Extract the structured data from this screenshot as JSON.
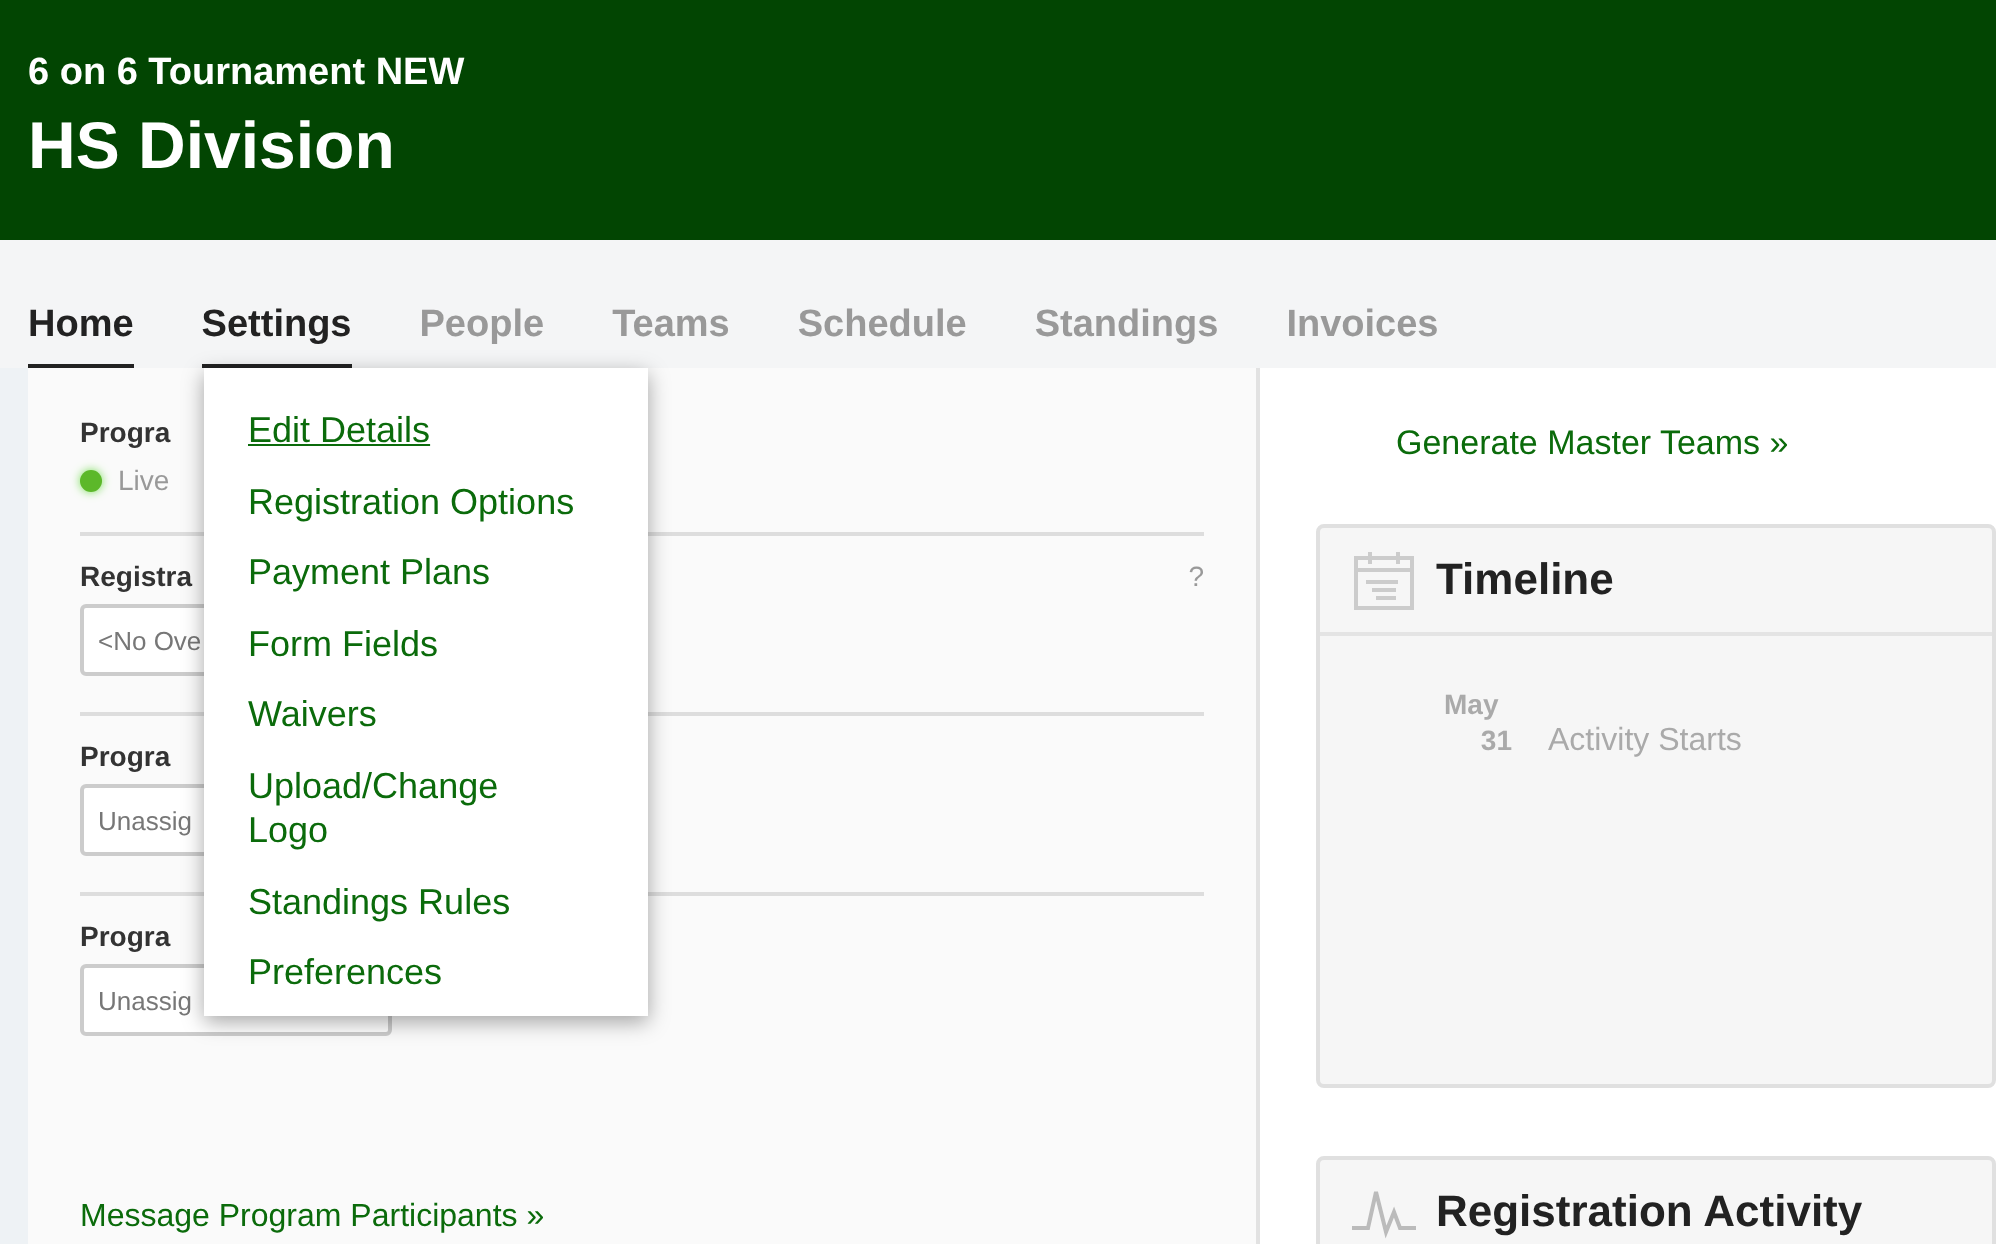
{
  "header": {
    "subtitle": "6 on 6 Tournament NEW",
    "title": "HS Division"
  },
  "tabs": [
    {
      "label": "Home",
      "active": true
    },
    {
      "label": "Settings",
      "active": true
    },
    {
      "label": "People",
      "active": false
    },
    {
      "label": "Teams",
      "active": false
    },
    {
      "label": "Schedule",
      "active": false
    },
    {
      "label": "Standings",
      "active": false
    },
    {
      "label": "Invoices",
      "active": false
    }
  ],
  "settings_menu": [
    {
      "label": "Edit Details",
      "highlighted": true
    },
    {
      "label": "Registration Options",
      "highlighted": false
    },
    {
      "label": "Payment Plans",
      "highlighted": false
    },
    {
      "label": "Form Fields",
      "highlighted": false
    },
    {
      "label": "Waivers",
      "highlighted": false
    },
    {
      "label": "Upload/Change\nLogo",
      "highlighted": false
    },
    {
      "label": "Standings Rules",
      "highlighted": false
    },
    {
      "label": "Preferences",
      "highlighted": false
    }
  ],
  "left_panel": {
    "status": {
      "label": "Progra",
      "value": "Live",
      "on": true
    },
    "fields": [
      {
        "label": "Registra",
        "value": "<No Ove",
        "help": "?"
      },
      {
        "label": "Progra",
        "value": "Unassig"
      },
      {
        "label": "Progra",
        "value": "Unassig"
      }
    ],
    "link": "Message Program Participants »"
  },
  "right_panel": {
    "link": "Generate Master Teams »",
    "timeline": {
      "title": "Timeline",
      "events": [
        {
          "month": "May",
          "day": "31",
          "text": "Activity Starts"
        }
      ]
    },
    "activity": {
      "title": "Registration Activity"
    }
  }
}
